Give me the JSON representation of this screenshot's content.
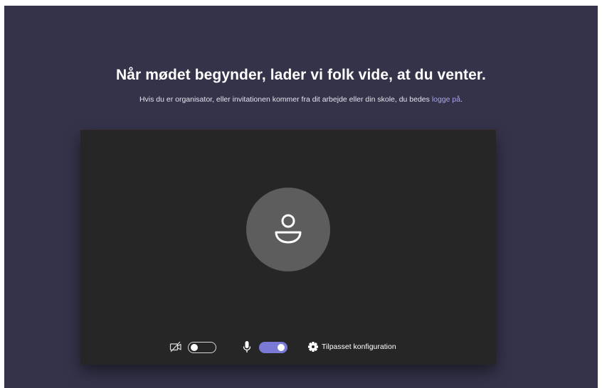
{
  "prejoin": {
    "title": "Når mødet begynder, lader vi folk vide, at du venter.",
    "subtitle_prefix": "Hvis du er organisator, eller invitationen kommer fra dit arbejde eller din skole, du bedes ",
    "signin_link": "logge på",
    "subtitle_suffix": "."
  },
  "controls": {
    "camera_icon": "camera-off-icon",
    "camera_enabled": false,
    "mic_icon": "microphone-icon",
    "mic_enabled": true,
    "settings_icon": "gear-icon",
    "settings_label": "Tilpasset konfiguration"
  },
  "colors": {
    "background": "#34334a",
    "preview": "#262626",
    "avatar": "#5d5d5d",
    "accent": "#7b79d6",
    "link": "#a8a6e8"
  }
}
